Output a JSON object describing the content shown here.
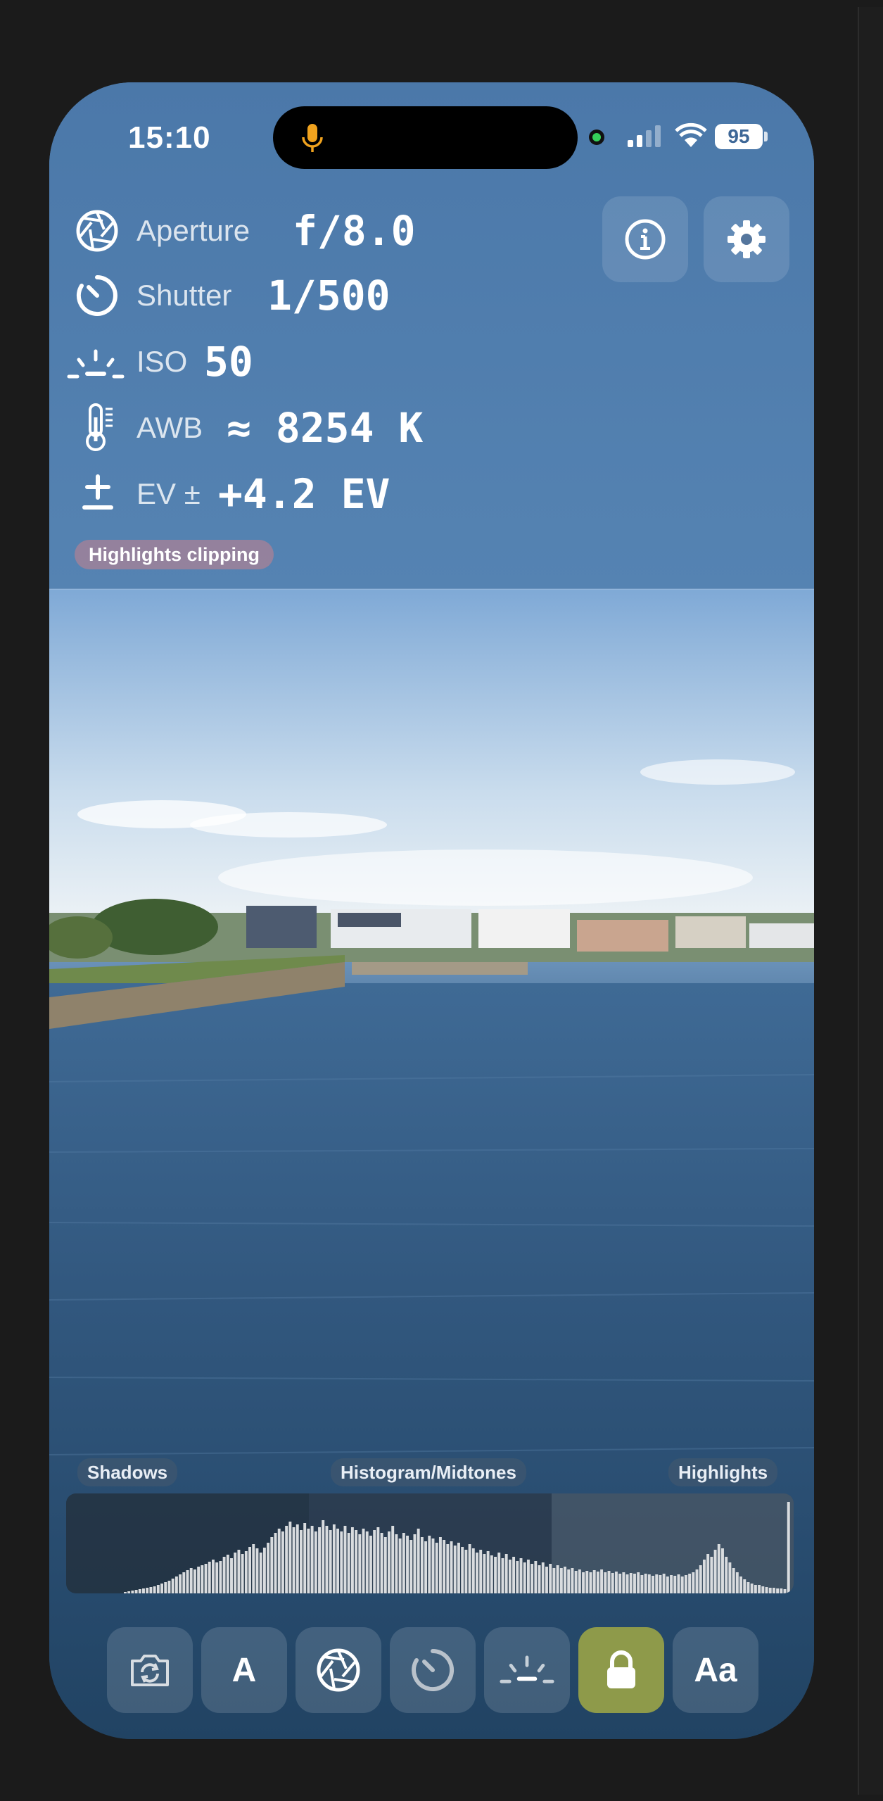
{
  "status_bar": {
    "time": "15:10",
    "battery": "95"
  },
  "exposure": {
    "aperture": {
      "label": "Aperture",
      "value": "f/8.0"
    },
    "shutter": {
      "label": "Shutter",
      "value": "1/500"
    },
    "iso": {
      "label": "ISO",
      "value": "50"
    },
    "white_balance": {
      "label": "AWB",
      "value": "≈ 8254 K"
    },
    "ev": {
      "label": "EV ±",
      "value": "+4.2 EV"
    }
  },
  "warning": "Highlights clipping",
  "histogram": {
    "shadows_label": "Shadows",
    "midtones_label": "Histogram/Midtones",
    "highlights_label": "Highlights",
    "bins": [
      2,
      3,
      4,
      5,
      6,
      7,
      8,
      9,
      10,
      12,
      14,
      16,
      18,
      21,
      24,
      27,
      30,
      33,
      36,
      34,
      38,
      40,
      42,
      45,
      48,
      44,
      46,
      52,
      55,
      50,
      58,
      62,
      56,
      60,
      66,
      70,
      64,
      58,
      65,
      72,
      80,
      86,
      92,
      88,
      96,
      102,
      94,
      98,
      90,
      100,
      92,
      96,
      88,
      94,
      104,
      96,
      90,
      98,
      92,
      88,
      96,
      86,
      94,
      90,
      84,
      92,
      88,
      82,
      90,
      94,
      86,
      80,
      88,
      96,
      84,
      78,
      86,
      82,
      76,
      84,
      92,
      80,
      74,
      82,
      78,
      72,
      80,
      76,
      70,
      74,
      68,
      72,
      66,
      62,
      70,
      64,
      58,
      62,
      56,
      60,
      54,
      52,
      58,
      50,
      56,
      48,
      52,
      46,
      50,
      44,
      48,
      42,
      46,
      40,
      44,
      38,
      42,
      36,
      40,
      36,
      38,
      34,
      36,
      32,
      34,
      30,
      32,
      30,
      33,
      31,
      34,
      30,
      32,
      29,
      31,
      28,
      30,
      27,
      29,
      28,
      30,
      26,
      28,
      27,
      25,
      27,
      26,
      28,
      24,
      26,
      25,
      27,
      24,
      26,
      28,
      30,
      34,
      40,
      48,
      56,
      52,
      62,
      70,
      64,
      52,
      44,
      36,
      30,
      24,
      20,
      16,
      14,
      12,
      12,
      10,
      9,
      8,
      8,
      7,
      7,
      6,
      130
    ]
  },
  "toolbar": {
    "auto_label": "A",
    "font_label": "Aa"
  },
  "colors": {
    "accent_lock": "#8e9a4a",
    "warning": "#c8828c"
  }
}
